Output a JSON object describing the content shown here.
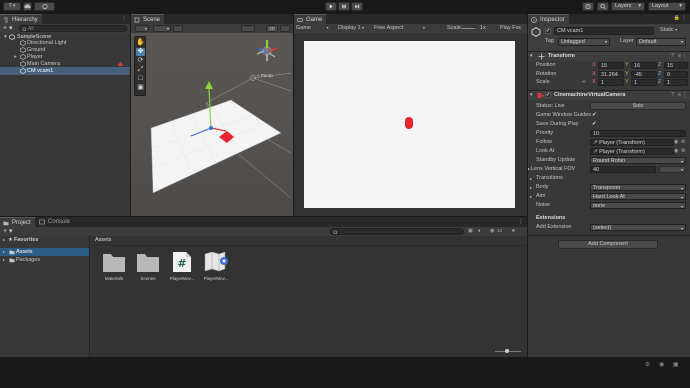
{
  "toolbar": {
    "account_label": "T ▾",
    "layers_label": "Layers",
    "layout_label": "Layout"
  },
  "hierarchy": {
    "tab_label": "Hierarchy",
    "search_placeholder": "All",
    "items": [
      {
        "label": "SampleScene"
      },
      {
        "label": "Directional Light"
      },
      {
        "label": "Ground"
      },
      {
        "label": "Player"
      },
      {
        "label": "Main Camera"
      },
      {
        "label": "CM vcam1"
      }
    ]
  },
  "scene": {
    "tab_label": "Scene",
    "mode_2d": "2D",
    "persp_label": "< Persp"
  },
  "game": {
    "tab_label": "Game",
    "view_mode": "Game",
    "display": "Display 1",
    "aspect": "Free Aspect",
    "scale_label": "Scale",
    "scale_value": "1x",
    "play_label": "Play Foc"
  },
  "inspector": {
    "tab_label": "Inspector",
    "object_name": "CM vcam1",
    "static_label": "Static",
    "tag_label": "Tag",
    "tag_value": "Untagged",
    "layer_label": "Layer",
    "layer_value": "Default",
    "transform": {
      "title": "Transform",
      "position_label": "Position",
      "rotation_label": "Rotation",
      "scale_label": "Scale",
      "position": [
        "15",
        "16",
        "15"
      ],
      "rotation": [
        "31.264",
        "-45",
        "0"
      ],
      "scale": [
        "1",
        "1",
        "1"
      ]
    },
    "vcam": {
      "title": "CinemachineVirtualCamera",
      "status_label": "Status: Live",
      "solo_label": "Solo",
      "rows": [
        {
          "label": "Game Window Guides",
          "value": "✔"
        },
        {
          "label": "Save During Play",
          "value": "✔"
        },
        {
          "label": "Priority",
          "value": "10"
        },
        {
          "label": "Follow",
          "value": "↗ Player (Transform)"
        },
        {
          "label": "Look At",
          "value": "↗ Player (Transform)"
        },
        {
          "label": "Standby Update",
          "value": "Round Robin"
        },
        {
          "label": "Lens Vertical FOV",
          "value": "40"
        }
      ],
      "transitions_label": "Transitions",
      "body_label": "Body",
      "body_value": "Transposer",
      "aim_label": "Aim",
      "aim_value": "Hard Look At",
      "noise_label": "Noise",
      "noise_value": "none"
    },
    "extensions_title": "Extensions",
    "add_extension_label": "Add Extension",
    "add_extension_value": "(select)",
    "add_component_label": "Add Component"
  },
  "project": {
    "tab_project": "Project",
    "tab_console": "Console",
    "favorites_label": "Favorites",
    "tree": [
      {
        "label": "Assets"
      },
      {
        "label": "Packages"
      }
    ],
    "breadcrumb": "Assets",
    "assets": [
      {
        "label": "Materials",
        "icon": "folder-icon"
      },
      {
        "label": "Scenes",
        "icon": "folder-icon"
      },
      {
        "label": "PlayerMov...",
        "icon": "csharp-script-icon"
      },
      {
        "label": "PlayerMov...",
        "icon": "input-actions-icon"
      }
    ],
    "badge_count": "12"
  },
  "colors": {
    "accent": "#2c5d87",
    "cube_red": "#e8242c",
    "gizmo_green": "#8ad33a",
    "gizmo_red": "#d43b3b",
    "gizmo_blue": "#3a6fe0"
  }
}
